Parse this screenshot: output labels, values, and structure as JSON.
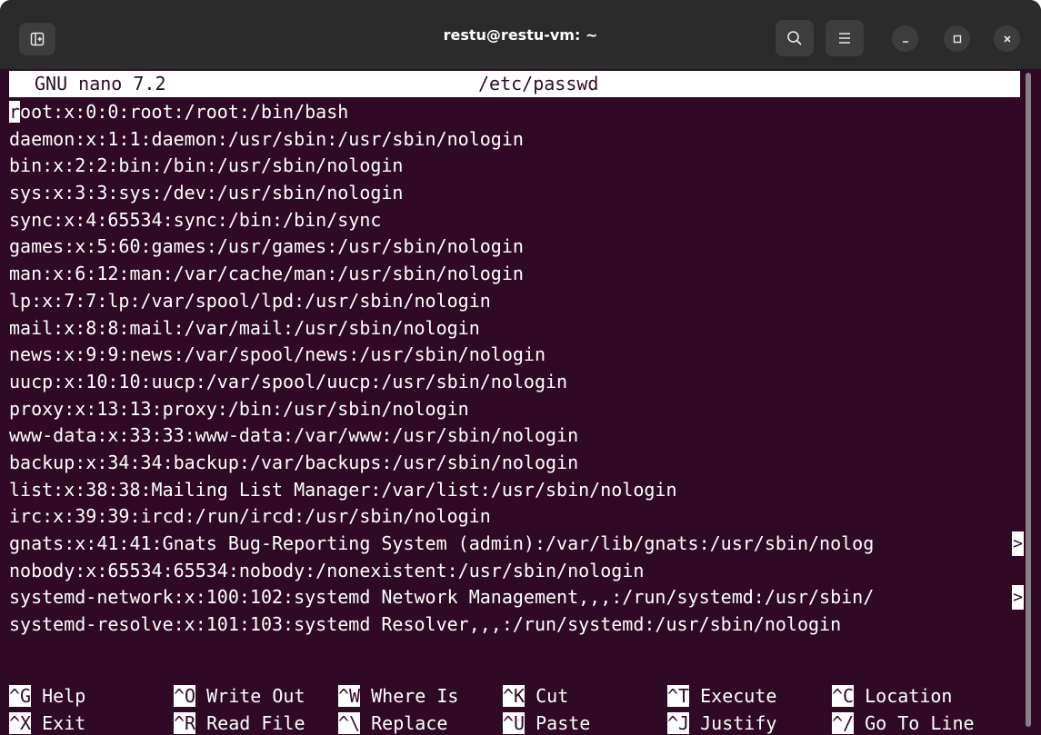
{
  "window": {
    "title": "restu@restu-vm: ~"
  },
  "header": {
    "version": "GNU nano 7.2",
    "filename": "/etc/passwd"
  },
  "lines": [
    {
      "text": "root:x:0:0:root:/root:/bin/bash",
      "cursor": true
    },
    {
      "text": "daemon:x:1:1:daemon:/usr/sbin:/usr/sbin/nologin"
    },
    {
      "text": "bin:x:2:2:bin:/bin:/usr/sbin/nologin"
    },
    {
      "text": "sys:x:3:3:sys:/dev:/usr/sbin/nologin"
    },
    {
      "text": "sync:x:4:65534:sync:/bin:/bin/sync"
    },
    {
      "text": "games:x:5:60:games:/usr/games:/usr/sbin/nologin"
    },
    {
      "text": "man:x:6:12:man:/var/cache/man:/usr/sbin/nologin"
    },
    {
      "text": "lp:x:7:7:lp:/var/spool/lpd:/usr/sbin/nologin"
    },
    {
      "text": "mail:x:8:8:mail:/var/mail:/usr/sbin/nologin"
    },
    {
      "text": "news:x:9:9:news:/var/spool/news:/usr/sbin/nologin"
    },
    {
      "text": "uucp:x:10:10:uucp:/var/spool/uucp:/usr/sbin/nologin"
    },
    {
      "text": "proxy:x:13:13:proxy:/bin:/usr/sbin/nologin"
    },
    {
      "text": "www-data:x:33:33:www-data:/var/www:/usr/sbin/nologin"
    },
    {
      "text": "backup:x:34:34:backup:/var/backups:/usr/sbin/nologin"
    },
    {
      "text": "list:x:38:38:Mailing List Manager:/var/list:/usr/sbin/nologin"
    },
    {
      "text": "irc:x:39:39:ircd:/run/ircd:/usr/sbin/nologin"
    },
    {
      "text": "gnats:x:41:41:Gnats Bug-Reporting System (admin):/var/lib/gnats:/usr/sbin/nolog",
      "more": ">"
    },
    {
      "text": "nobody:x:65534:65534:nobody:/nonexistent:/usr/sbin/nologin"
    },
    {
      "text": "systemd-network:x:100:102:systemd Network Management,,,:/run/systemd:/usr/sbin/",
      "more": ">"
    },
    {
      "text": "systemd-resolve:x:101:103:systemd Resolver,,,:/run/systemd:/usr/sbin/nologin"
    }
  ],
  "shortcuts": [
    [
      {
        "key": "^G",
        "label": "Help"
      },
      {
        "key": "^O",
        "label": "Write Out"
      },
      {
        "key": "^W",
        "label": "Where Is"
      },
      {
        "key": "^K",
        "label": "Cut"
      },
      {
        "key": "^T",
        "label": "Execute"
      },
      {
        "key": "^C",
        "label": "Location"
      }
    ],
    [
      {
        "key": "^X",
        "label": "Exit"
      },
      {
        "key": "^R",
        "label": "Read File"
      },
      {
        "key": "^\\",
        "label": "Replace"
      },
      {
        "key": "^U",
        "label": "Paste"
      },
      {
        "key": "^J",
        "label": "Justify"
      },
      {
        "key": "^/",
        "label": "Go To Line"
      }
    ]
  ],
  "icons": {
    "new_tab": "new-tab-icon",
    "search": "search-icon",
    "menu": "hamburger-menu-icon",
    "minimize": "minimize-icon",
    "maximize": "maximize-icon",
    "close": "close-icon"
  },
  "colors": {
    "terminal_bg": "#300a24",
    "titlebar_bg": "#2b2b2b",
    "text": "#ffffff"
  }
}
